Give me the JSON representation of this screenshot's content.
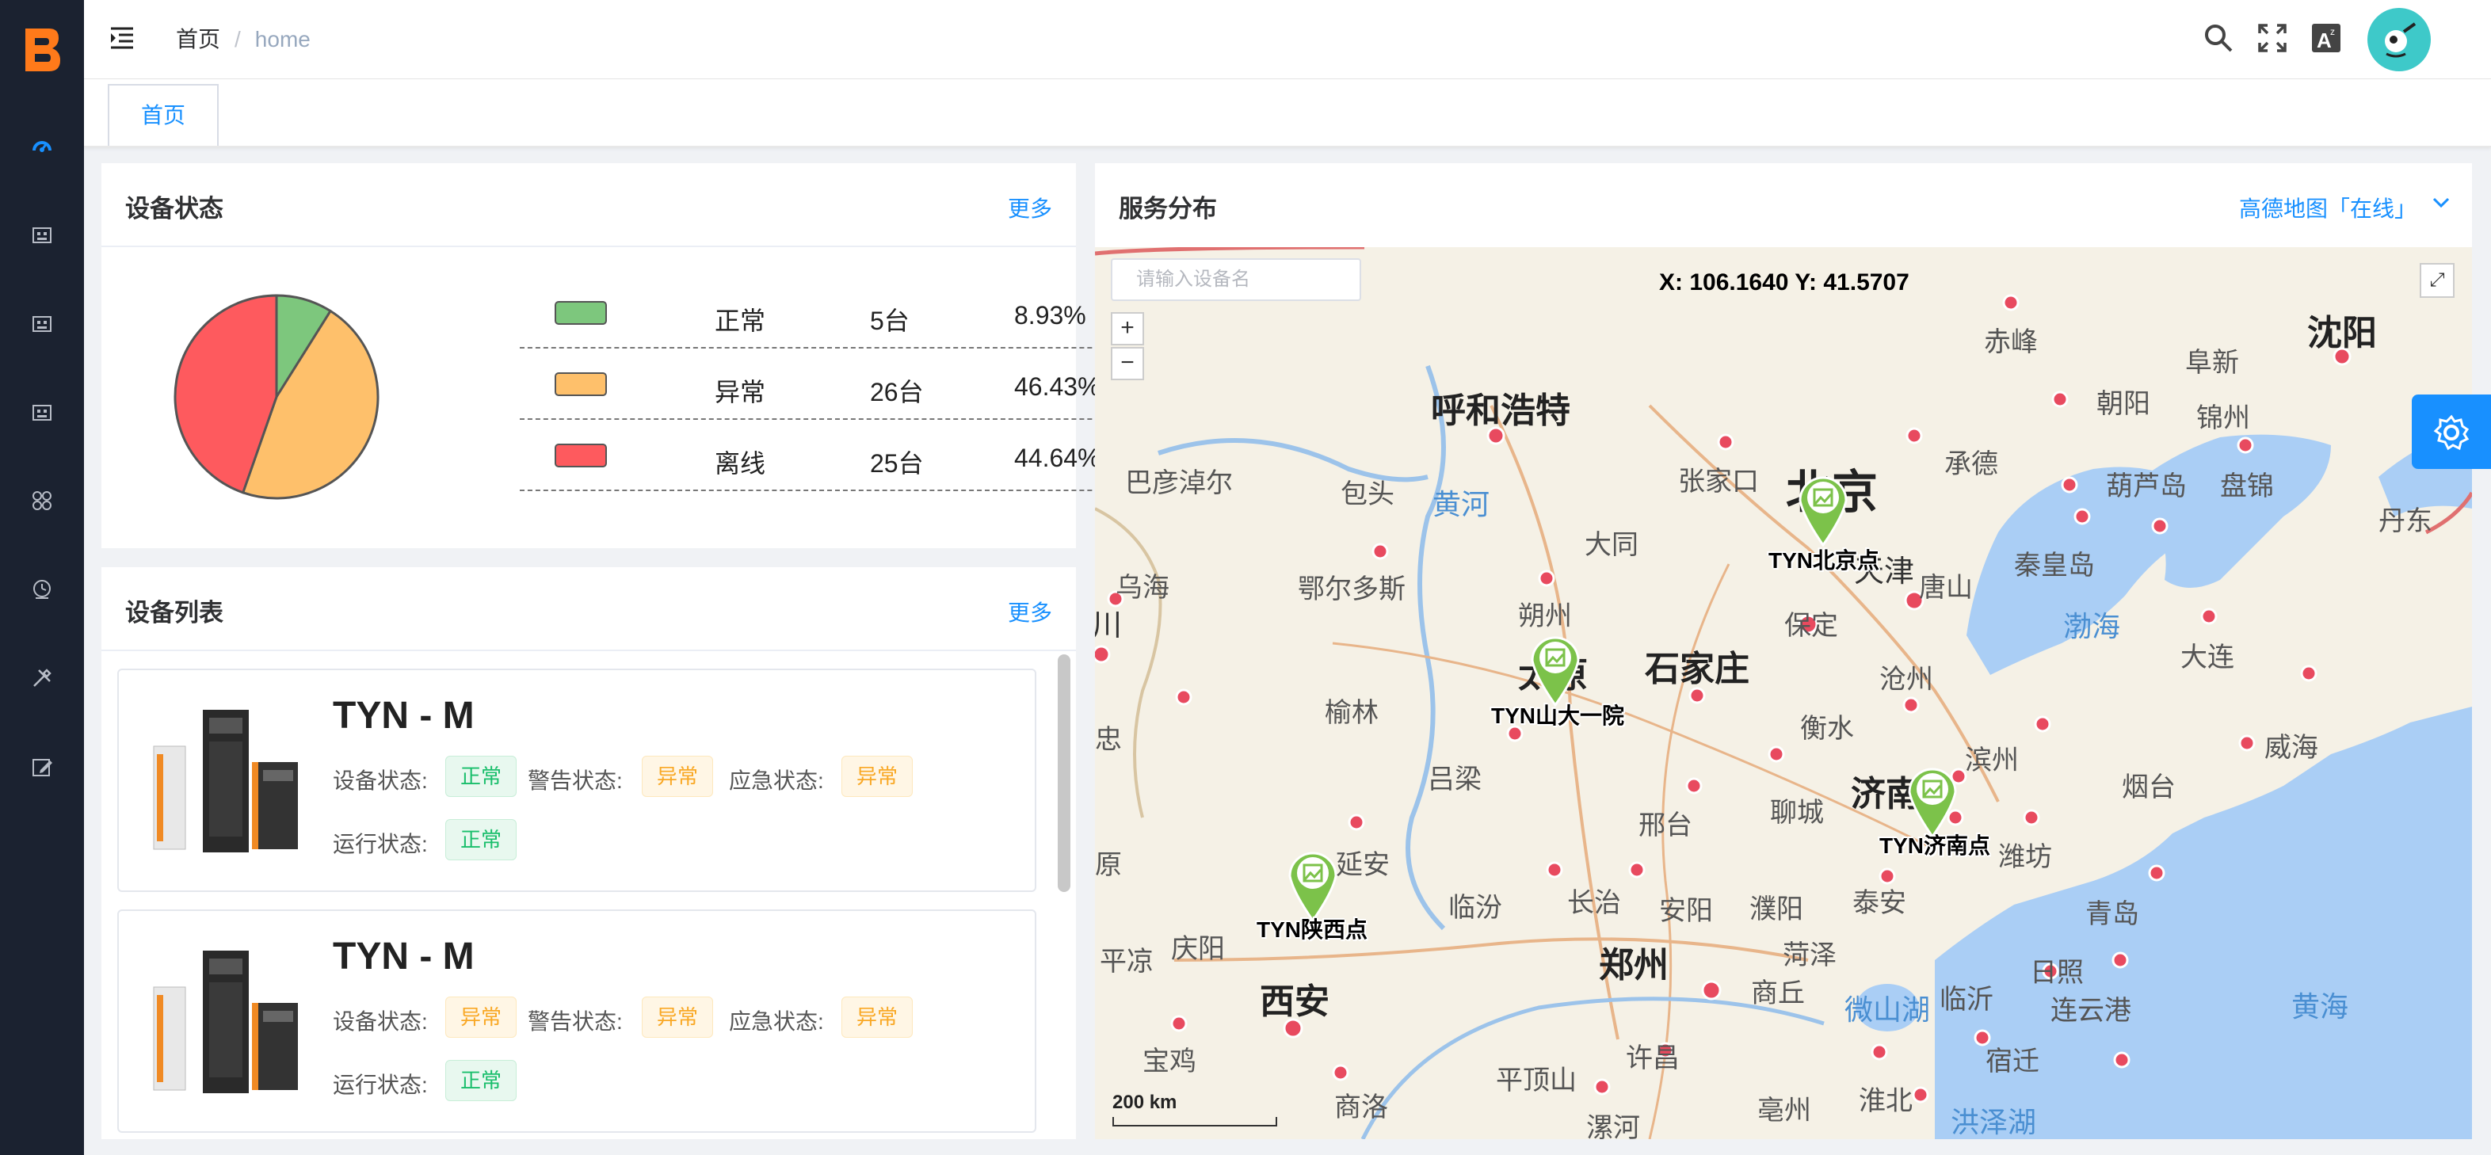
{
  "breadcrumb": {
    "home": "首页",
    "current": "home"
  },
  "tabs": [
    {
      "label": "首页"
    }
  ],
  "device_status": {
    "title": "设备状态",
    "more": "更多",
    "rows": [
      {
        "name": "正常",
        "count": "5台",
        "percent": "8.93%",
        "color": "#7dc77d"
      },
      {
        "name": "异常",
        "count": "26台",
        "percent": "46.43%",
        "color": "#fec06b"
      },
      {
        "name": "离线",
        "count": "25台",
        "percent": "44.64%",
        "color": "#fe5a5e"
      }
    ]
  },
  "chart_data": {
    "type": "pie",
    "labels": [
      "正常",
      "异常",
      "离线"
    ],
    "values": [
      5,
      26,
      25
    ],
    "colors": [
      "#7dc77d",
      "#fec06b",
      "#fe5a5e"
    ]
  },
  "device_list": {
    "title": "设备列表",
    "more": "更多",
    "labels": {
      "device": "设备状态:",
      "alarm": "警告状态:",
      "emergency": "应急状态:",
      "run": "运行状态:"
    },
    "items": [
      {
        "name": "TYN - M",
        "device": "正常",
        "alarm": "异常",
        "emergency": "异常",
        "run": "正常"
      },
      {
        "name": "TYN - M",
        "device": "异常",
        "alarm": "异常",
        "emergency": "异常",
        "run": "正常"
      }
    ]
  },
  "service_map": {
    "title": "服务分布",
    "map_source": "高德地图「在线」",
    "search_placeholder": "请输入设备名",
    "coords": "X: 106.1640   Y: 41.5707",
    "zoom_in": "+",
    "zoom_out": "−",
    "scale": "200 km",
    "markers": [
      "TYN北京点",
      "TYN山大一院",
      "TYN济南点",
      "TYN陕西点"
    ],
    "cities": {
      "shenyang": "沈阳",
      "chifeng": "赤峰",
      "fuxin": "阜新",
      "chaoyang": "朝阳",
      "jinzhou": "锦州",
      "huhehaote": "呼和浩特",
      "chengde": "承德",
      "zhangjiakou": "张家口",
      "beijing": "北京",
      "bayannaoer": "巴彦淖尔",
      "baotou": "包头",
      "huanghe": "黄河",
      "datong": "大同",
      "huludao": "葫芦岛",
      "panjin": "盘锦",
      "dandong": "丹东",
      "qinhuangdao": "秦皇岛",
      "tangshan": "唐山",
      "tianjin": "天津",
      "wuhai": "乌海",
      "eerduosi": "鄂尔多斯",
      "shuozhou": "朔州",
      "baoding": "保定",
      "bohai": "渤海",
      "dalian": "大连",
      "taiyuan": "太原",
      "shijiazhuang": "石家庄",
      "cangzhou": "沧州",
      "yulin": "榆林",
      "hengshui": "衡水",
      "binzhou": "滨州",
      "weihai": "威海",
      "lvliang": "吕梁",
      "jinan": "济南",
      "yantai": "烟台",
      "liaocheng": "聊城",
      "xingtai": "邢台",
      "weifang": "潍坊",
      "yanan": "延安",
      "linfen": "临汾",
      "changzhi": "长治",
      "anyang": "安阳",
      "puyang": "濮阳",
      "taian": "泰安",
      "qingdao": "青岛",
      "qingyang": "庆阳",
      "pingliang": "平凉",
      "zhengzhou": "郑州",
      "heze": "菏泽",
      "rizhao": "日照",
      "xian": "西安",
      "shangqiu": "商丘",
      "linyi": "临沂",
      "weishanhu": "微山湖",
      "lianyungang": "连云港",
      "huanghai": "黄海",
      "baoji": "宝鸡",
      "pingdingshan": "平顶山",
      "xuchang": "许昌",
      "suqian": "宿迁",
      "shangluo": "商洛",
      "luohe": "漯河",
      "bozhou": "亳州",
      "huaibei": "淮北",
      "hongzehu": "洪泽湖",
      "chuan": "川",
      "zhong": "忠",
      "yuan": "原"
    }
  }
}
